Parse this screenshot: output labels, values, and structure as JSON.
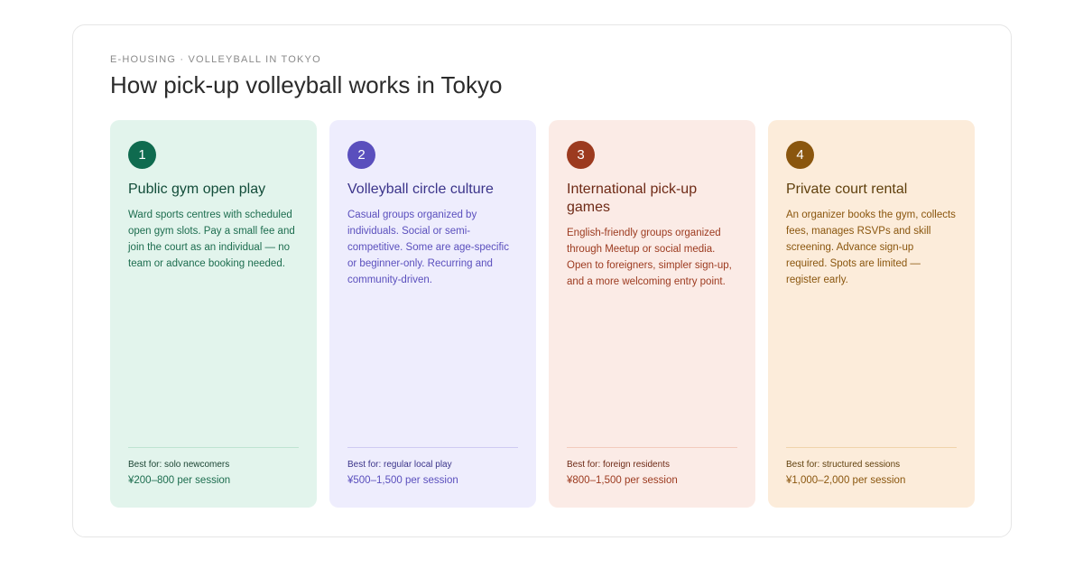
{
  "header": {
    "eyebrow": "E-HOUSING · VOLLEYBALL IN TOKYO",
    "title": "How pick-up volleyball works in Tokyo"
  },
  "cards": [
    {
      "number": "1",
      "title": "Public gym open play",
      "description": "Ward sports centres with scheduled open gym slots. Pay a small fee and join the court as an individual — no team or advance booking needed.",
      "best_for": "Best for: solo newcomers",
      "price": "¥200–800 per session",
      "accent": "#0f6b4f"
    },
    {
      "number": "2",
      "title": "Volleyball circle culture",
      "description": "Casual groups organized by individuals. Social or semi-competitive. Some are age-specific or beginner-only. Recurring and community-driven.",
      "best_for": "Best for: regular local play",
      "price": "¥500–1,500 per session",
      "accent": "#5a4fbd"
    },
    {
      "number": "3",
      "title": "International pick-up games",
      "description": "English-friendly groups organized through Meetup or social media. Open to foreigners, simpler sign-up, and a more welcoming entry point.",
      "best_for": "Best for: foreign residents",
      "price": "¥800–1,500 per session",
      "accent": "#9c3a1f"
    },
    {
      "number": "4",
      "title": "Private court rental",
      "description": "An organizer books the gym, collects fees, manages RSVPs and skill screening. Advance sign-up required. Spots are limited — register early.",
      "best_for": "Best for: structured sessions",
      "price": "¥1,000–2,000 per session",
      "accent": "#8a560e"
    }
  ]
}
